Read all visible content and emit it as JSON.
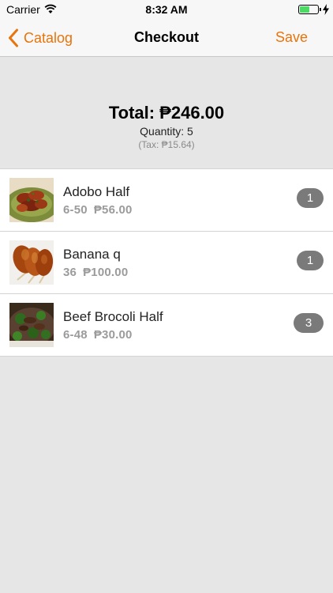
{
  "status_bar": {
    "carrier": "Carrier",
    "time": "8:32 AM",
    "battery_level": 0.55,
    "battery_color": "#4cd964"
  },
  "nav": {
    "back_label": "Catalog",
    "title": "Checkout",
    "save_label": "Save",
    "accent_color": "#e8740c"
  },
  "summary": {
    "total": "Total: ₱246.00",
    "quantity": "Quantity: 5",
    "tax": "(Tax: ₱15.64)"
  },
  "items": [
    {
      "name": "Adobo Half",
      "code": "6-50",
      "price": "₱56.00",
      "qty": "1",
      "image": "adobo-photo"
    },
    {
      "name": "Banana q",
      "code": "36",
      "price": "₱100.00",
      "qty": "1",
      "image": "banana-q-photo"
    },
    {
      "name": "Beef Brocoli Half",
      "code": "6-48",
      "price": "₱30.00",
      "qty": "3",
      "image": "beef-broccoli-photo"
    }
  ]
}
